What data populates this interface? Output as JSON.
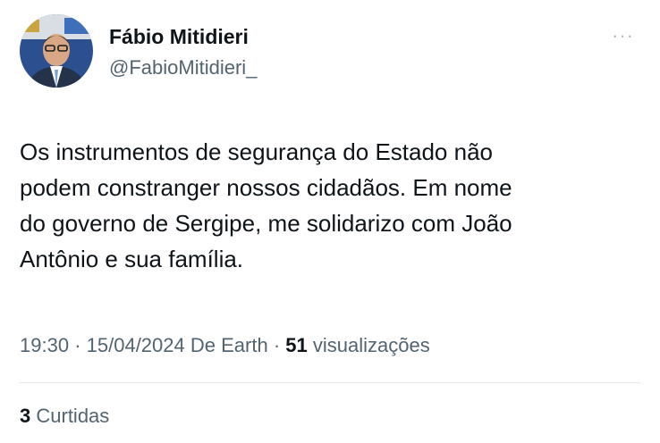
{
  "author": {
    "name": "Fábio Mitidieri",
    "handle": "@FabioMitidieri_"
  },
  "tweet": {
    "lines": [
      "Os instrumentos de segurança do Estado não",
      "podem constranger nossos cidadãos. Em nome",
      "do governo de Sergipe, me solidarizo com João",
      "Antônio e sua família."
    ]
  },
  "meta": {
    "time": "19:30",
    "date": "15/04/2024",
    "source": "De Earth",
    "views_count": "51",
    "views_label": "visualizações"
  },
  "engagement": {
    "likes_count": "3",
    "likes_label": "Curtidas"
  },
  "more_menu": {
    "label": "···"
  },
  "colors": {
    "text": "#0f1419",
    "secondary": "#536471",
    "divider": "#e6e9ec"
  },
  "icons": [
    "more-options-icon"
  ]
}
